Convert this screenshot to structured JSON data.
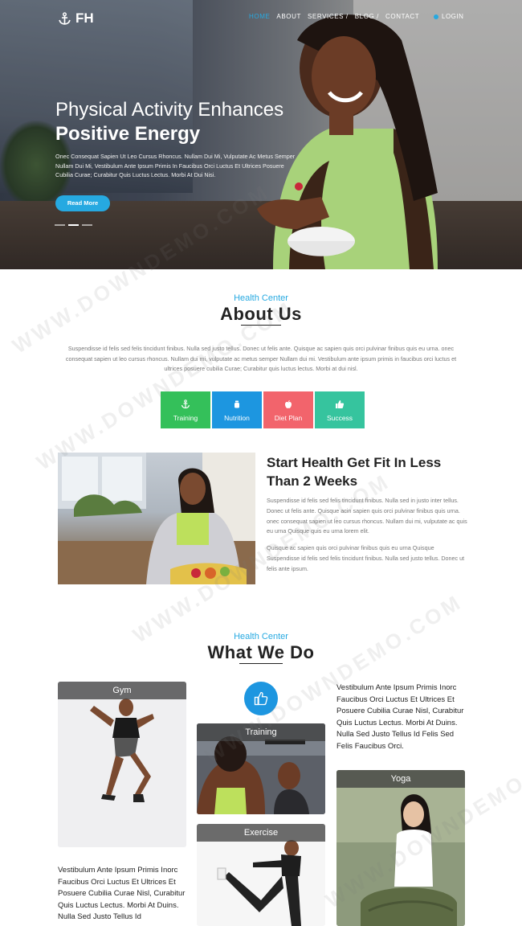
{
  "nav": {
    "logo_text": "FH",
    "items": [
      {
        "label": "HOME",
        "active": true
      },
      {
        "label": "ABOUT",
        "active": false
      },
      {
        "label": "SERVICES /",
        "active": false
      },
      {
        "label": "BLOG /",
        "active": false
      },
      {
        "label": "CONTACT",
        "active": false
      }
    ],
    "login": "LOGIN"
  },
  "hero": {
    "title_line1": "Physical Activity Enhances",
    "title_line2": "Positive Energy",
    "description": "Onec Consequat Sapien Ut Leo Cursus Rhoncus. Nullam Dui Mi, Vulputate Ac Metus Semper Nullam Dui Mi, Vestibulum Ante Ipsum Primis In Faucibus Orci Luctus Et Ultrices Posuere Cubilia Curae; Curabitur Quis Luctus Lectus. Morbi At Dui Nisi.",
    "button": "Read More"
  },
  "about": {
    "kicker": "Health Center",
    "heading": "About Us",
    "paragraph": "Suspendisse id felis sed felis tincidunt finibus. Nulla sed justo tellus. Donec ut felis ante. Quisque ac sapien quis orci pulvinar finibus quis eu urna. onec consequat sapien ut leo cursus rhoncus. Nullam dui mi, vulputate ac metus semper Nullam dui mi. Vestibulum ante ipsum primis in faucibus orci luctus et ultrices posuere cubilia Curae; Curabitur quis luctus lectus. Morbi at dui nisl.",
    "features": [
      {
        "label": "Training",
        "icon": "anchor-icon"
      },
      {
        "label": "Nutrition",
        "icon": "apple-icon"
      },
      {
        "label": "Diet Plan",
        "icon": "apple-logo-icon"
      },
      {
        "label": "Success",
        "icon": "thumbs-up-icon"
      }
    ],
    "fit_title": "Start Health Get Fit In Less Than 2 Weeks",
    "fit_p1": "Suspendisse id felis sed felis tincidunt finibus. Nulla sed in justo inter tellus. Donec ut felis ante. Quisque acin sapien quis orci pulvinar finibus quis urna. onec consequat sapien ut leo cursus rhoncus. Nullam dui mi, vulputate ac quis eu urna Quisque quis eu urna lorem elit.",
    "fit_p2": "Quisque ac sapien quis orci pulvinar finibus quis eu urna Quisque Suspendisse id felis sed felis tincidunt finibus. Nulla sed justo tellus. Donec ut felis ante ipsum."
  },
  "what_we_do": {
    "kicker": "Health Center",
    "heading": "What We Do",
    "cards": {
      "gym": "Gym",
      "training": "Training",
      "exercise": "Exercise",
      "yoga": "Yoga"
    },
    "text_right": "Vestibulum Ante Ipsum Primis Inorc Faucibus Orci Luctus Et Ultrices Et Posuere Cubilia Curae Nisl, Curabitur Quis Luctus Lectus. Morbi At Duins. Nulla Sed Justo Tellus Id Felis Sed Felis Faucibus Orci.",
    "text_left": "Vestibulum Ante Ipsum Primis Inorc Faucibus Orci Luctus Et Ultrices Et Posuere Cubilia Curae Nisl, Curabitur Quis Luctus Lectus. Morbi At Duins. Nulla Sed Justo Tellus Id"
  },
  "watermark": "WWW.DOWNDEMO.COM",
  "colors": {
    "accent": "#26a9e1",
    "training": "#34c05a",
    "nutrition": "#1d96e0",
    "diet_plan": "#f2646c",
    "success": "#36c49e"
  }
}
